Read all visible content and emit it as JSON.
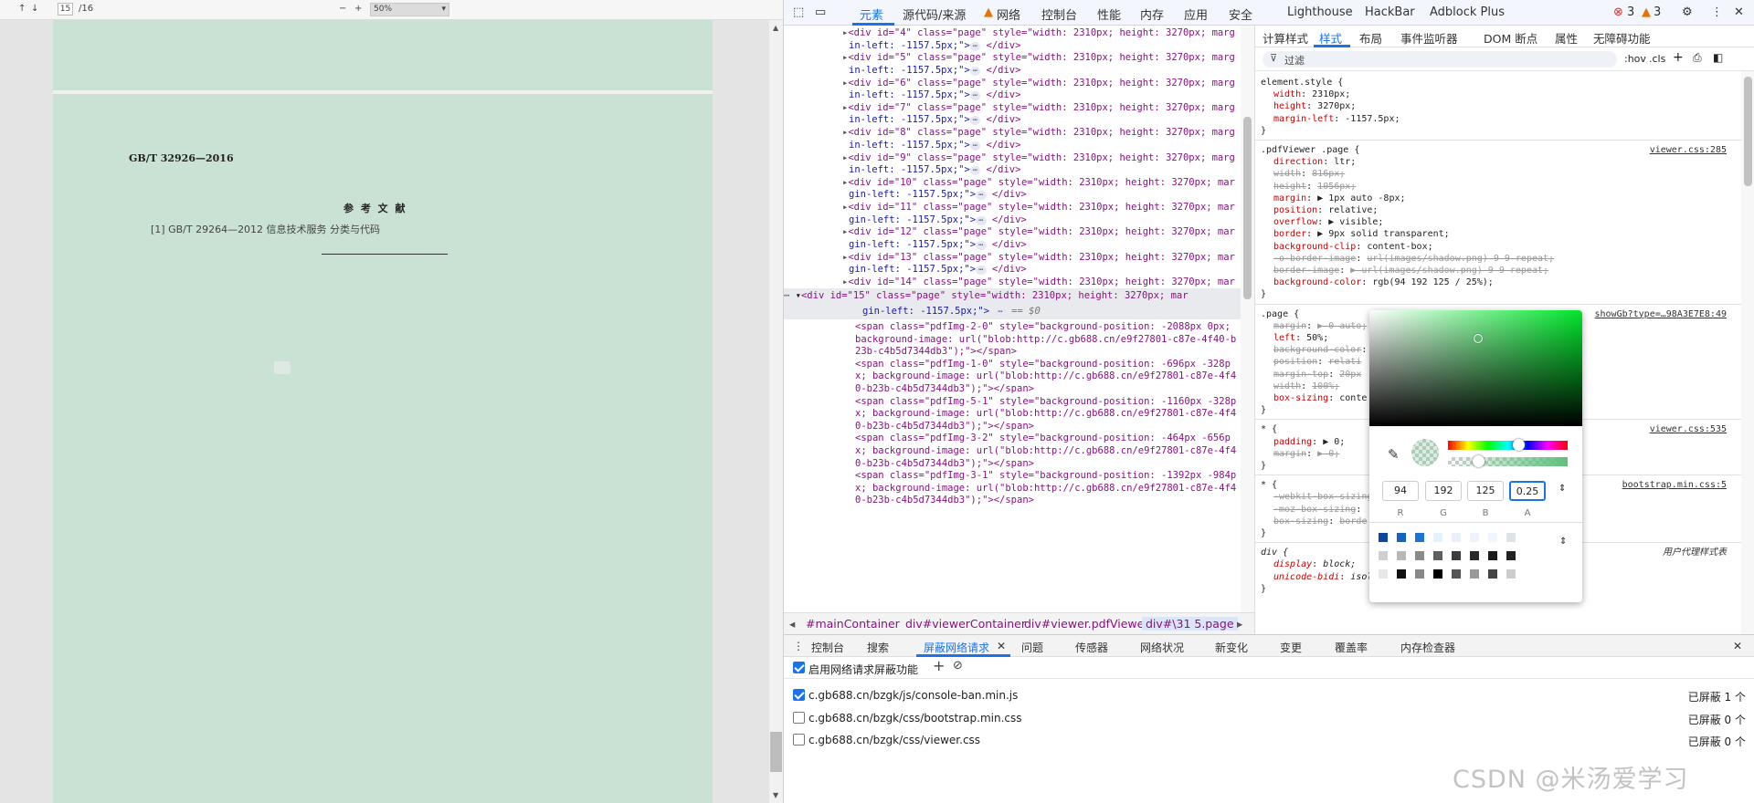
{
  "pdf": {
    "toolbar": {
      "up": "↑",
      "down": "↓",
      "page": "15",
      "total": "/16",
      "zoom_out": "−",
      "zoom_in": "+",
      "zoom": "50%"
    },
    "doc_code": "GB/T 32926—2016",
    "references_title": "参 考 文 献",
    "ref1": "[1]  GB/T 29264—2012  信息技术服务  分类与代码"
  },
  "devtools": {
    "tabs": [
      "元素",
      "源代码/来源",
      "网络",
      "控制台",
      "性能",
      "内存",
      "应用",
      "安全",
      "Lighthouse",
      "HackBar",
      "Adblock Plus"
    ],
    "errors": "3",
    "warnings": "3",
    "dom_lines": [
      {
        "id": "4",
        "t": "<div id=\"4\" class=\"page\" style=\"width: 2310px; height: 3270px; marg",
        "c": "in-left: -1157.5px;\">"
      },
      {
        "id": "5",
        "t": "<div id=\"5\" class=\"page\" style=\"width: 2310px; height: 3270px; marg",
        "c": "in-left: -1157.5px;\">"
      },
      {
        "id": "6",
        "t": "<div id=\"6\" class=\"page\" style=\"width: 2310px; height: 3270px; marg",
        "c": "in-left: -1157.5px;\">"
      },
      {
        "id": "7",
        "t": "<div id=\"7\" class=\"page\" style=\"width: 2310px; height: 3270px; marg",
        "c": "in-left: -1157.5px;\">"
      },
      {
        "id": "8",
        "t": "<div id=\"8\" class=\"page\" style=\"width: 2310px; height: 3270px; marg",
        "c": "in-left: -1157.5px;\">"
      },
      {
        "id": "9",
        "t": "<div id=\"9\" class=\"page\" style=\"width: 2310px; height: 3270px; marg",
        "c": "in-left: -1157.5px;\">"
      },
      {
        "id": "10",
        "t": "<div id=\"10\" class=\"page\" style=\"width: 2310px; height: 3270px; mar",
        "c": "gin-left: -1157.5px;\">"
      },
      {
        "id": "11",
        "t": "<div id=\"11\" class=\"page\" style=\"width: 2310px; height: 3270px; mar",
        "c": "gin-left: -1157.5px;\">"
      },
      {
        "id": "12",
        "t": "<div id=\"12\" class=\"page\" style=\"width: 2310px; height: 3270px; mar",
        "c": "gin-left: -1157.5px;\">"
      },
      {
        "id": "13",
        "t": "<div id=\"13\" class=\"page\" style=\"width: 2310px; height: 3270px; mar",
        "c": "gin-left: -1157.5px;\">"
      },
      {
        "id": "14",
        "t": "<div id=\"14\" class=\"page\" style=\"width: 2310px; height: 3270px; mar",
        "c": "gin-left: -1157.5px;\">"
      }
    ],
    "sel_line1": "<div id=\"15\" class=\"page\" style=\"width: 2310px; height: 3270px; mar",
    "sel_line2": "gin-left: -1157.5px;\">",
    "sel_eq": "== $0",
    "span_lines": [
      "<span class=\"pdfImg-2-0\" style=\"background-position: -2088px 0px;",
      "background-image: url(\"blob:http://c.gb688.cn/e9f27801-c87e-4f40-b",
      "23b-c4b5d7344db3\");\"></span>",
      "<span class=\"pdfImg-1-0\" style=\"background-position: -696px -328p",
      "x; background-image: url(\"blob:http://c.gb688.cn/e9f27801-c87e-4f4",
      "0-b23b-c4b5d7344db3\");\"></span>",
      "<span class=\"pdfImg-5-1\" style=\"background-position: -1160px -328p",
      "x; background-image: url(\"blob:http://c.gb688.cn/e9f27801-c87e-4f4",
      "0-b23b-c4b5d7344db3\");\"></span>",
      "<span class=\"pdfImg-3-2\" style=\"background-position: -464px -656p",
      "x; background-image: url(\"blob:http://c.gb688.cn/e9f27801-c87e-4f4",
      "0-b23b-c4b5d7344db3\");\"></span>",
      "<span class=\"pdfImg-3-1\" style=\"background-position: -1392px -984p",
      "x; background-image: url(\"blob:http://c.gb688.cn/e9f27801-c87e-4f4",
      "0-b23b-c4b5d7344db3\");\"></span>"
    ],
    "breadcrumbs": [
      "#mainContainer",
      "div#viewerContainer",
      "div#viewer.pdfViewer",
      "div#\\31 5.page"
    ],
    "style_tabs": [
      "计算样式",
      "样式",
      "布局",
      "事件监听器",
      "DOM 断点",
      "属性",
      "无障碍功能"
    ],
    "filter": "过滤",
    "hov": ":hov",
    ".cls": ".cls",
    "rules": {
      "el": [
        "element.style {",
        "width: 2310px;",
        "height: 3270px;",
        "margin-left: -1157.5px;",
        "}"
      ],
      "pdfviewer": {
        "sel": ".pdfViewer .page {",
        "src": "viewer.css:285",
        "props": [
          [
            "direction",
            "ltr;",
            false
          ],
          [
            "width",
            "816px;",
            true
          ],
          [
            "height",
            "1056px;",
            true
          ],
          [
            "margin",
            "▶ 1px auto -8px;",
            false
          ],
          [
            "position",
            "relative;",
            false
          ],
          [
            "overflow",
            "▶ visible;",
            false
          ],
          [
            "border",
            "▶ 9px solid  transparent;",
            false
          ],
          [
            "background-clip",
            "content-box;",
            false
          ],
          [
            "-o-border-image",
            "url(images/shadow.png) 9 9 repeat;",
            true
          ],
          [
            "border-image",
            "▶ url(images/shadow.png) 9 9 repeat;",
            true
          ],
          [
            "background-color",
            "rgb(94 192 125 / 25%);",
            false
          ]
        ]
      },
      "page": {
        "sel": ".page {",
        "src": "showGb?type=…98A3E7E8:49",
        "props": [
          [
            "margin",
            "▶ 0 auto;",
            true
          ],
          [
            "left",
            "50%;",
            false
          ],
          [
            "background-color",
            "",
            true
          ],
          [
            "position",
            "relati",
            true
          ],
          [
            "margin-top",
            "20px",
            true
          ],
          [
            "width",
            "100%;",
            true
          ],
          [
            "box-sizing",
            "conte",
            false
          ]
        ]
      },
      "star1": {
        "sel": "* {",
        "src": "viewer.css:535",
        "props": [
          [
            "padding",
            "▶ 0;",
            false
          ],
          [
            "margin",
            "▶ 0;",
            true
          ]
        ]
      },
      "star2": {
        "sel": "* {",
        "src": "bootstrap.min.css:5",
        "props": [
          [
            "-webkit-box-sizing",
            "",
            true
          ],
          [
            "-moz-box-sizing",
            "",
            true
          ],
          [
            "box-sizing",
            "borde",
            true
          ]
        ]
      },
      "div": {
        "sel": "div {",
        "src": "用户代理样式表",
        "props": [
          [
            "display",
            "block;"
          ],
          [
            "unicode-bidi",
            "isolate;"
          ]
        ]
      }
    },
    "picker": {
      "r": "94",
      "g": "192",
      "b": "125",
      "a": "0.25",
      "lr": "R",
      "lg": "G",
      "lb": "B",
      "la": "A"
    },
    "drawer_tabs": [
      "控制台",
      "搜索",
      "屏蔽网络请求",
      "问题",
      "传感器",
      "网络状况",
      "新变化",
      "变更",
      "覆盖率",
      "内存检查器"
    ],
    "enable_label": "启用网络请求屏蔽功能",
    "blocked": [
      {
        "url": "c.gb688.cn/bzgk/js/console-ban.min.js",
        "count": "已屏蔽 1 个",
        "on": true
      },
      {
        "url": "c.gb688.cn/bzgk/css/bootstrap.min.css",
        "count": "已屏蔽 0 个",
        "on": false
      },
      {
        "url": "c.gb688.cn/bzgk/css/viewer.css",
        "count": "已屏蔽 0 个",
        "on": false
      }
    ]
  },
  "watermark": "CSDN @米汤爱学习"
}
